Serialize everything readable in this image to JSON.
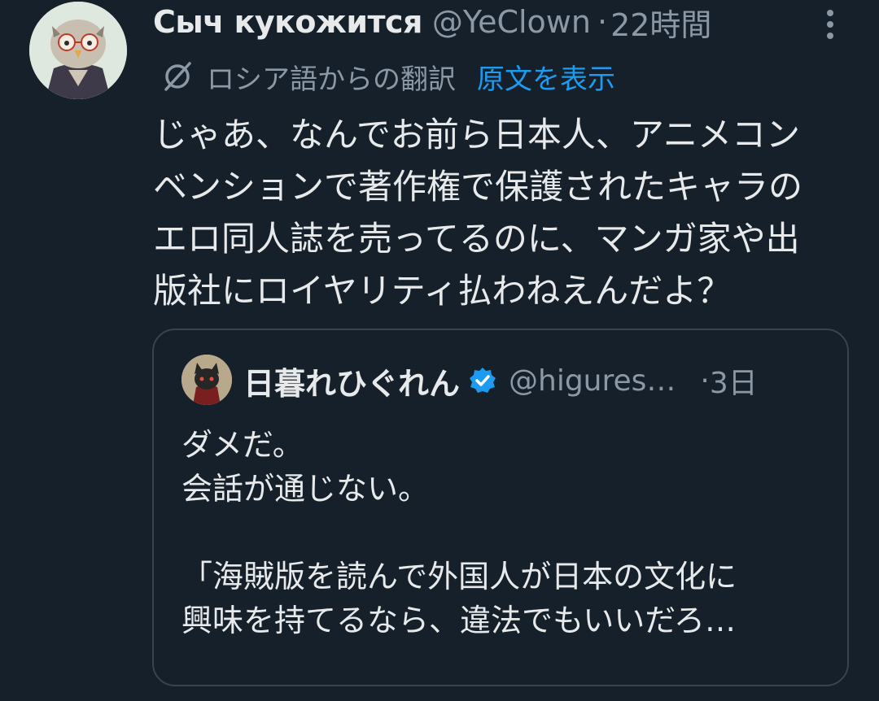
{
  "tweet": {
    "author": {
      "display_name": "Сыч кукожится",
      "handle": "@YeClown",
      "avatar_icon": "owl-avatar-icon"
    },
    "separator": "·",
    "time": "22時間",
    "more_icon": "more-vertical-icon",
    "translation": {
      "icon": "translate-icon",
      "label": "ロシア語からの翻訳",
      "show_original": "原文を表示"
    },
    "text_lines": [
      "じゃあ、なんでお前ら日本人、アニメコン",
      "ベンションで著作権で保護されたキャラの",
      "エロ同人誌を売ってるのに、マンガ家や出",
      "版社にロイヤリティ払わねえんだよ？"
    ]
  },
  "quote": {
    "author": {
      "display_name": "日暮れひぐれん",
      "handle": "@higures…",
      "avatar_icon": "cat-avatar-icon",
      "verified_icon": "verified-badge-icon"
    },
    "separator": "·",
    "time": "3日",
    "text_lines": [
      "ダメだ。",
      "会話が通じない。",
      "",
      "「海賊版を読んで外国人が日本の文化に",
      "興味を持てるなら、違法でもいいだろ…"
    ]
  },
  "colors": {
    "background": "#15202b",
    "text": "#e7e9ea",
    "secondary_text": "#8b98a5",
    "link": "#1d9bf0",
    "border": "#38444d"
  }
}
